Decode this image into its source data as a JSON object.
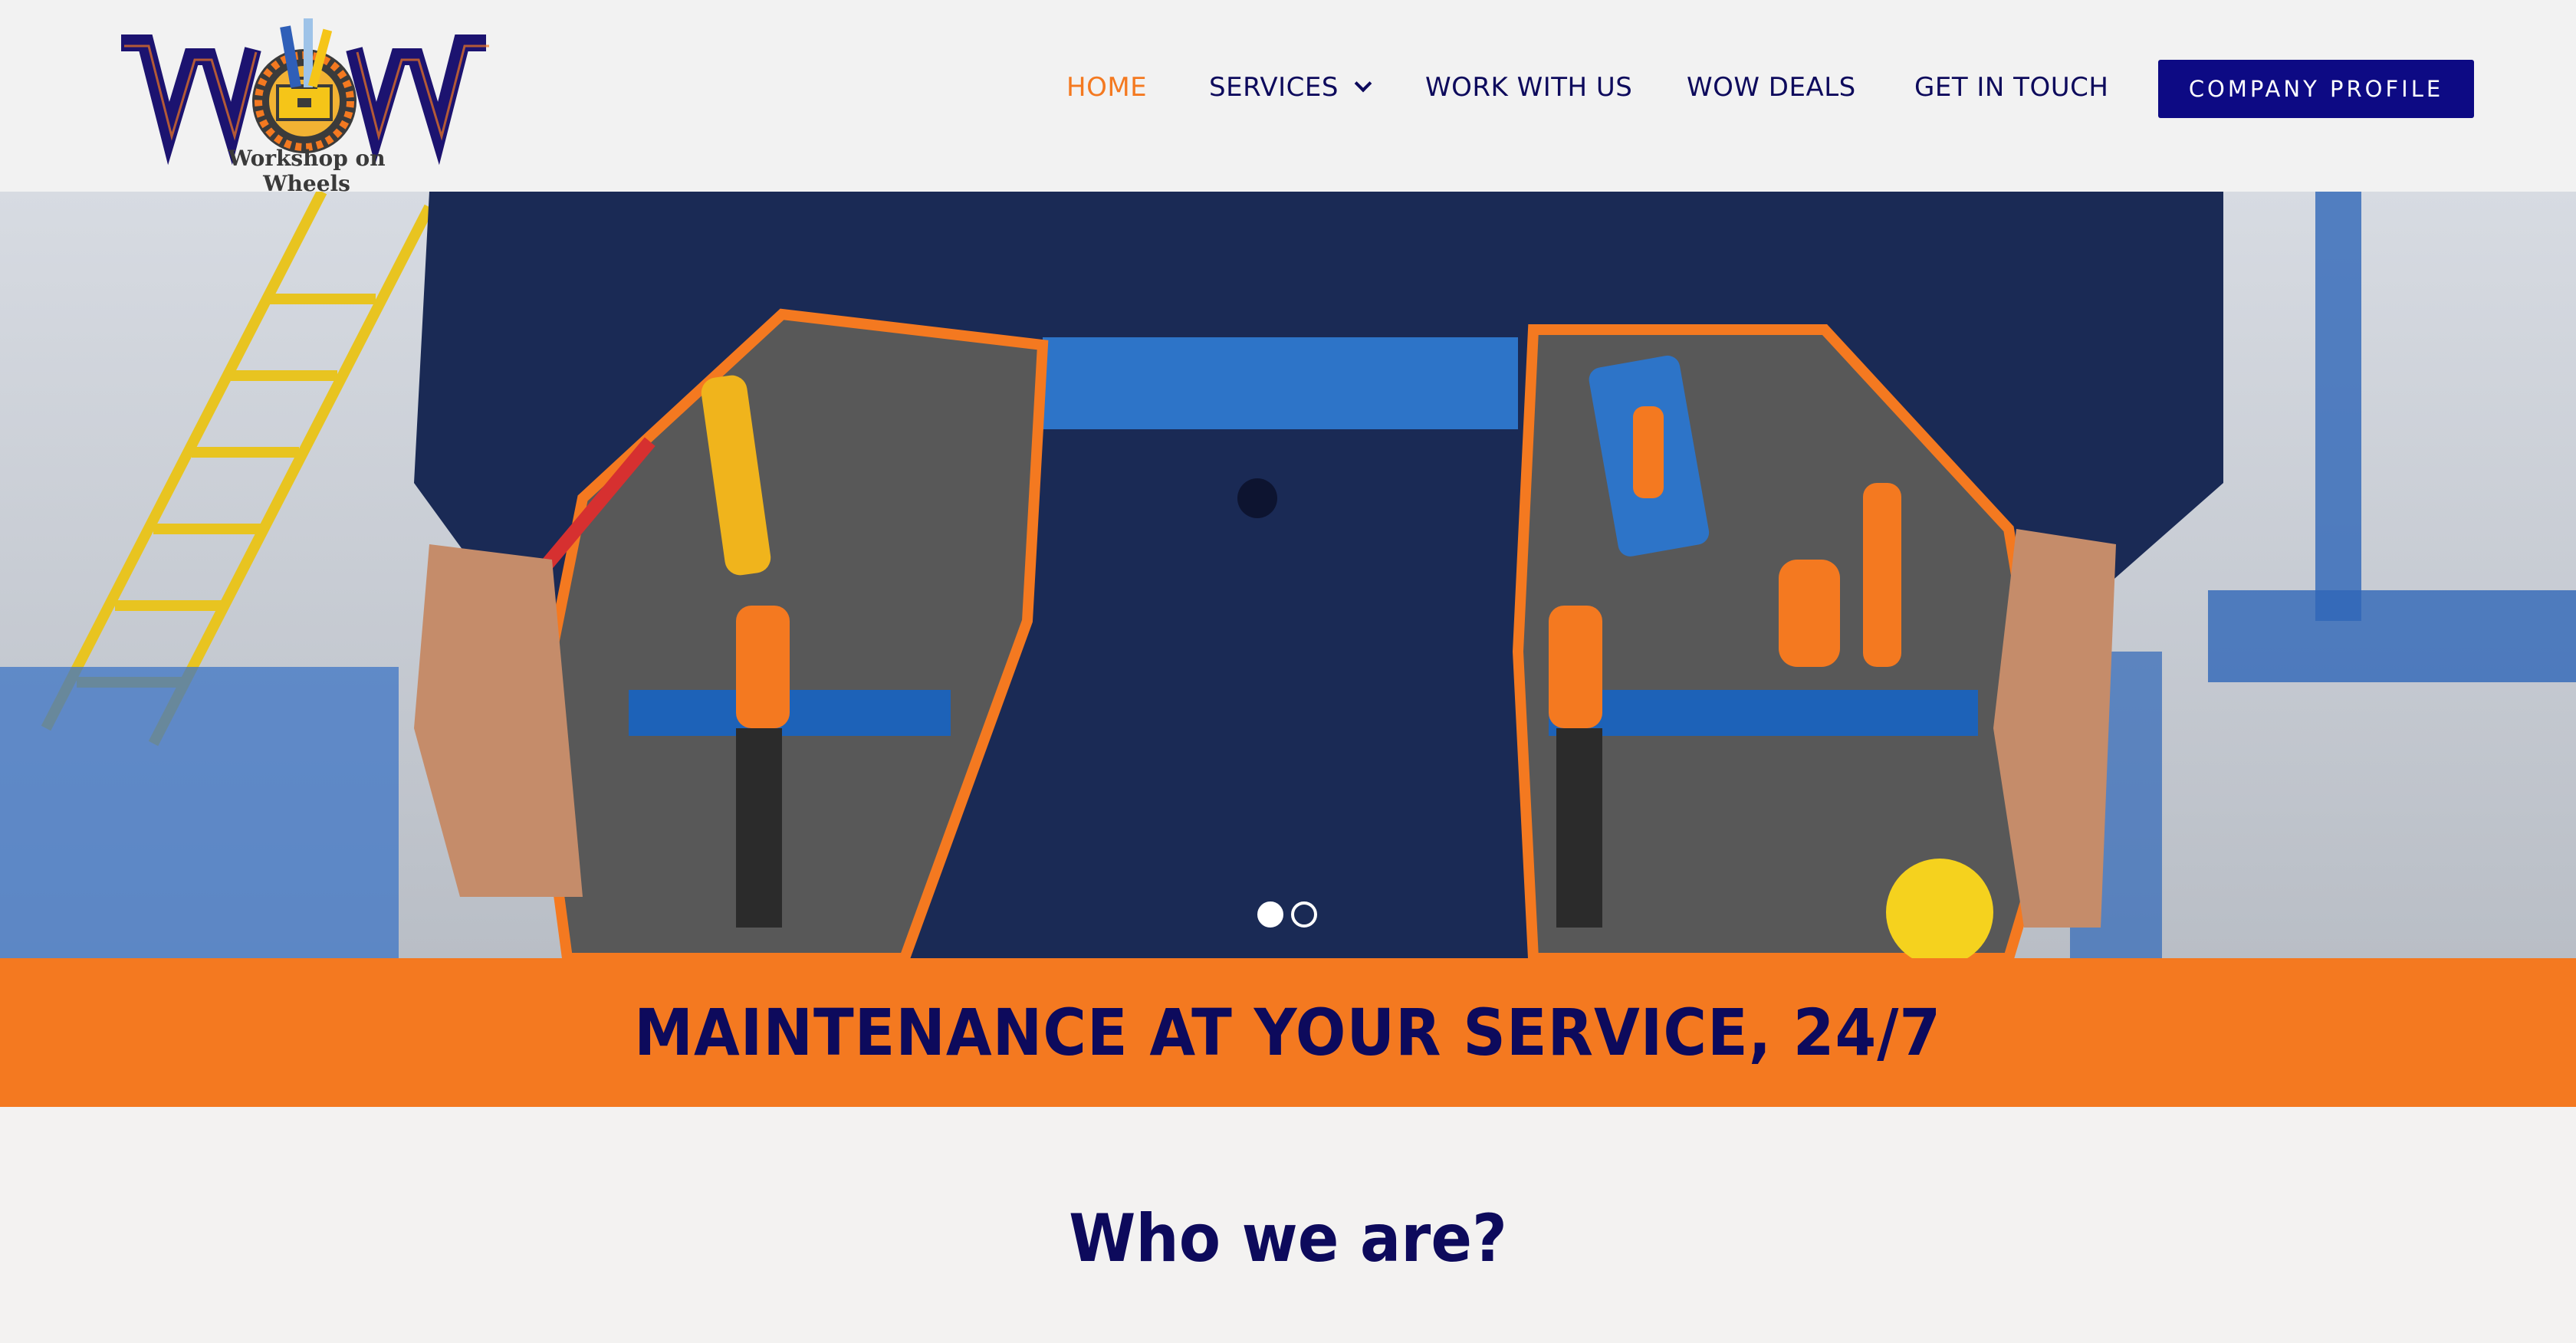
{
  "header": {
    "logo": {
      "wordmark": "WOW",
      "tagline": "Workshop on Wheels"
    },
    "nav": [
      {
        "label": "HOME",
        "active": true
      },
      {
        "label": "SERVICES",
        "has_dropdown": true
      },
      {
        "label": "WORK WITH US"
      },
      {
        "label": "WOW DEALS"
      },
      {
        "label": "GET IN TOUCH"
      }
    ],
    "cta_label": "COMPANY PROFILE"
  },
  "hero": {
    "image": "technician-tool-belt-photo",
    "slides": 2,
    "active_slide": 1
  },
  "banner": {
    "text": "MAINTENANCE AT YOUR SERVICE, 24/7"
  },
  "who": {
    "title": "Who we are?",
    "text": ""
  },
  "colors": {
    "brand_navy": "#0d0a5c",
    "cta_blue": "#0d0a84",
    "accent_orange": "#f47920",
    "header_bg": "#f2f2f2"
  }
}
